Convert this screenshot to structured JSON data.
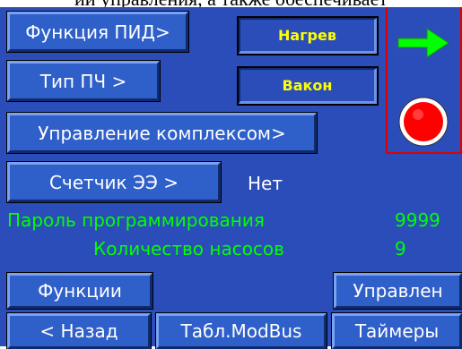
{
  "top_text": "ии управления, а также обеспечивает",
  "buttons": {
    "pid": "Функция ПИД>",
    "pch": "Тип ПЧ >",
    "complex": "Управление комплексом>",
    "counter": "Счетчик ЭЭ >",
    "functions": "Функции",
    "control": "Управлен",
    "back": "< Назад",
    "modbus": "Табл.ModBus",
    "timers": "Таймеры"
  },
  "indicators": {
    "heating": "Нагрев",
    "vakon": "Вакон"
  },
  "counter_value": "Нет",
  "fields": {
    "password_label": "Пароль программирования",
    "password_value": "9999",
    "pumps_label": "Количество насосов",
    "pumps_value": "9"
  },
  "colors": {
    "background": "#2a4dba",
    "button": "#2f5fc9",
    "accent_green": "#00ff00",
    "accent_yellow": "#ffff00",
    "alarm_red": "#e00000"
  },
  "icons": {
    "arrow": "green-arrow-right-icon",
    "status": "red-status-lamp-icon"
  }
}
